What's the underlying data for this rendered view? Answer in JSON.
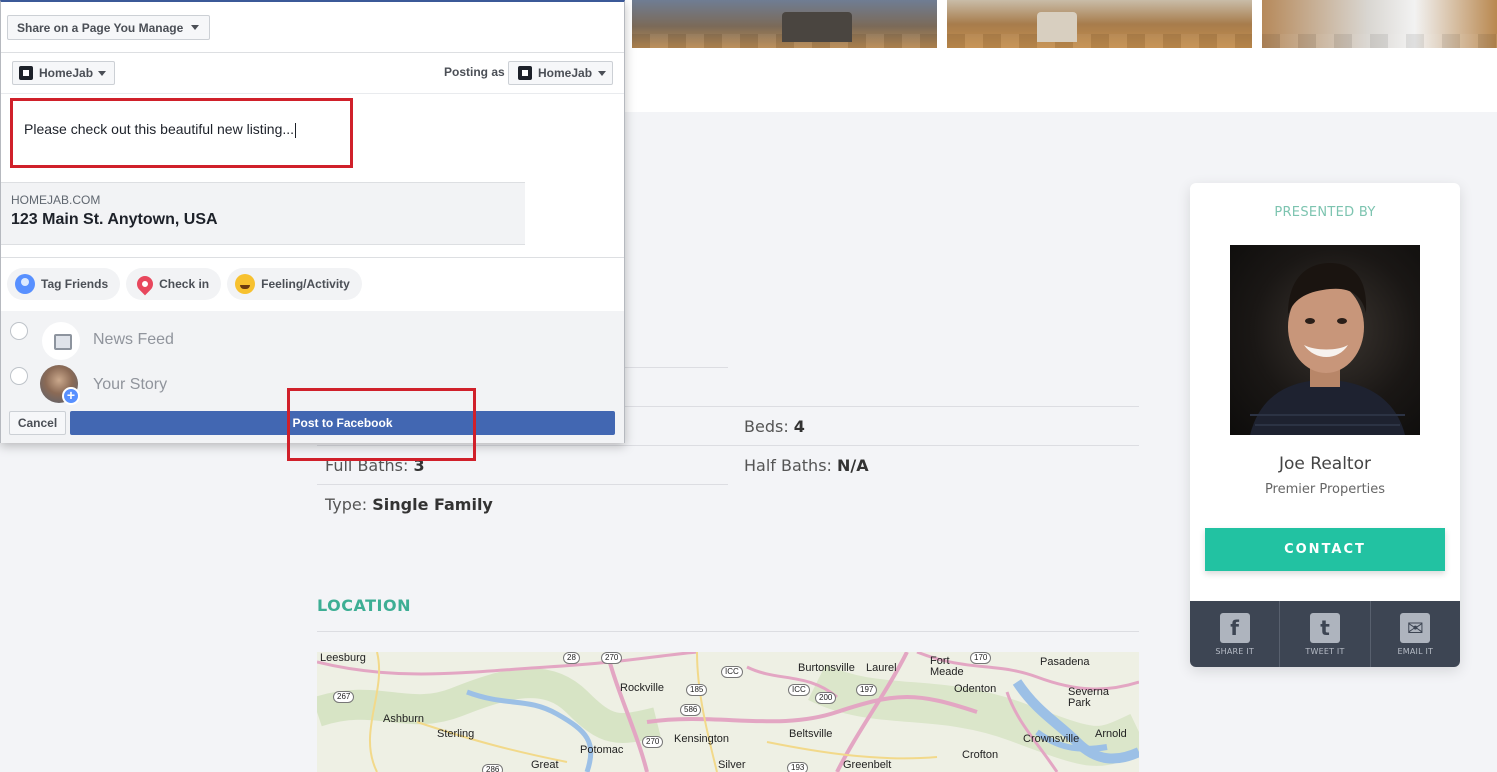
{
  "dialog": {
    "share_target": "Share on a Page You Manage",
    "page_selector": "HomeJab",
    "posting_as_label": "Posting as",
    "posting_as_value": "HomeJab",
    "message": "Please check out this beautiful new listing...",
    "link_preview": {
      "domain": "HOMEJAB.COM",
      "title": "123 Main St. Anytown, USA"
    },
    "actions": [
      {
        "label": "Tag Friends",
        "icon": "tag-friends-icon"
      },
      {
        "label": "Check in",
        "icon": "location-pin-icon"
      },
      {
        "label": "Feeling/Activity",
        "icon": "smiley-icon"
      }
    ],
    "destinations": [
      {
        "label": "News Feed",
        "icon": "news-feed-icon"
      },
      {
        "label": "Your Story",
        "icon": "avatar"
      }
    ],
    "cancel_label": "Cancel",
    "post_label": "Post to Facebook",
    "colors": {
      "facebook_blue": "#4267b2",
      "highlight_red": "#d0202a"
    }
  },
  "details": {
    "beds_label": "Beds:",
    "beds_value": "4",
    "full_baths_label": "Full Baths:",
    "full_baths_value": "3",
    "half_baths_label": "Half Baths:",
    "half_baths_value": "N/A",
    "type_label": "Type:",
    "type_value": "Single Family"
  },
  "location": {
    "title": "LOCATION",
    "map_labels": [
      "Leesburg",
      "Rockville",
      "Burtonsville",
      "Laurel",
      "Fort Meade",
      "Pasadena",
      "Odenton",
      "Severna Park",
      "Ashburn",
      "Sterling",
      "Potomac",
      "Kensington",
      "Beltsville",
      "Crownsville",
      "Arnold",
      "Crofton",
      "Great",
      "Silver",
      "Greenbelt"
    ],
    "shields": [
      "28",
      "270",
      "267",
      "185",
      "586",
      "200",
      "197",
      "170",
      "270",
      "286",
      "193",
      "ICC",
      "ICC"
    ]
  },
  "agent": {
    "presented_by": "PRESENTED BY",
    "name": "Joe Realtor",
    "company": "Premier Properties",
    "contact_label": "CONTACT",
    "share": [
      {
        "label": "SHARE IT",
        "icon": "facebook-icon",
        "glyph": "f"
      },
      {
        "label": "TWEET IT",
        "icon": "twitter-icon",
        "glyph": "t"
      },
      {
        "label": "EMAIL IT",
        "icon": "email-icon",
        "glyph": "✉"
      }
    ],
    "colors": {
      "accent": "#22c2a2",
      "share_bar": "#3d4553"
    }
  }
}
